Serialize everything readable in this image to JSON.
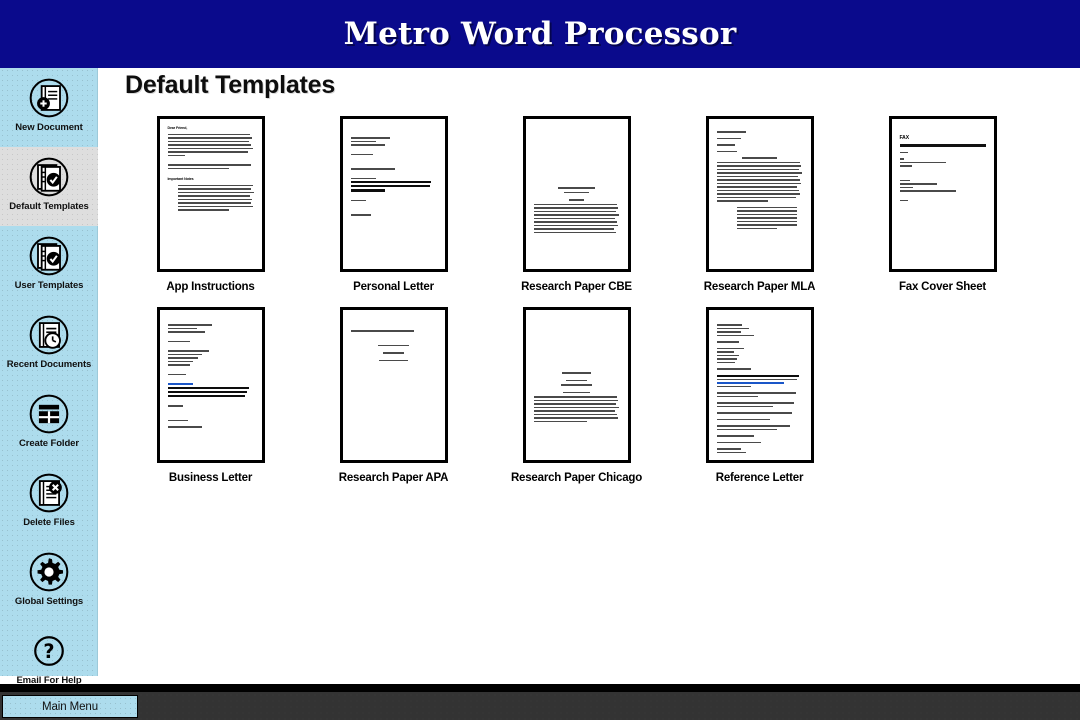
{
  "window": {
    "title": "Metro Word Processor",
    "title_bar_color": "#0a0a8c",
    "sidebar_color": "#addced",
    "footer_color": "#333333"
  },
  "sidebar": {
    "items": [
      {
        "label": "New Document",
        "icon": "document-plus-icon",
        "active": false
      },
      {
        "label": "Default Templates",
        "icon": "document-check-icon",
        "active": true
      },
      {
        "label": "User Templates",
        "icon": "document-check-icon",
        "active": false
      },
      {
        "label": "Recent Documents",
        "icon": "document-clock-icon",
        "active": false
      },
      {
        "label": "Create Folder",
        "icon": "folder-plus-icon",
        "active": false
      },
      {
        "label": "Delete Files",
        "icon": "document-x-icon",
        "active": false
      },
      {
        "label": "Global Settings",
        "icon": "gear-icon",
        "active": false
      },
      {
        "label": "Email For Help",
        "icon": "question-mark-icon",
        "active": false
      }
    ]
  },
  "main": {
    "heading": "Default Templates",
    "templates": [
      {
        "label": "App Instructions",
        "layout": "instructions"
      },
      {
        "label": "Personal Letter",
        "layout": "personal-letter"
      },
      {
        "label": "Research Paper CBE",
        "layout": "paper-cbe"
      },
      {
        "label": "Research Paper MLA",
        "layout": "paper-mla"
      },
      {
        "label": "Fax Cover Sheet",
        "layout": "fax-cover"
      },
      {
        "label": "Business Letter",
        "layout": "business-letter"
      },
      {
        "label": "Research Paper APA",
        "layout": "paper-apa"
      },
      {
        "label": "Research Paper Chicago",
        "layout": "paper-chicago"
      },
      {
        "label": "Reference Letter",
        "layout": "reference-letter"
      }
    ]
  },
  "footer": {
    "main_menu_label": "Main Menu"
  }
}
